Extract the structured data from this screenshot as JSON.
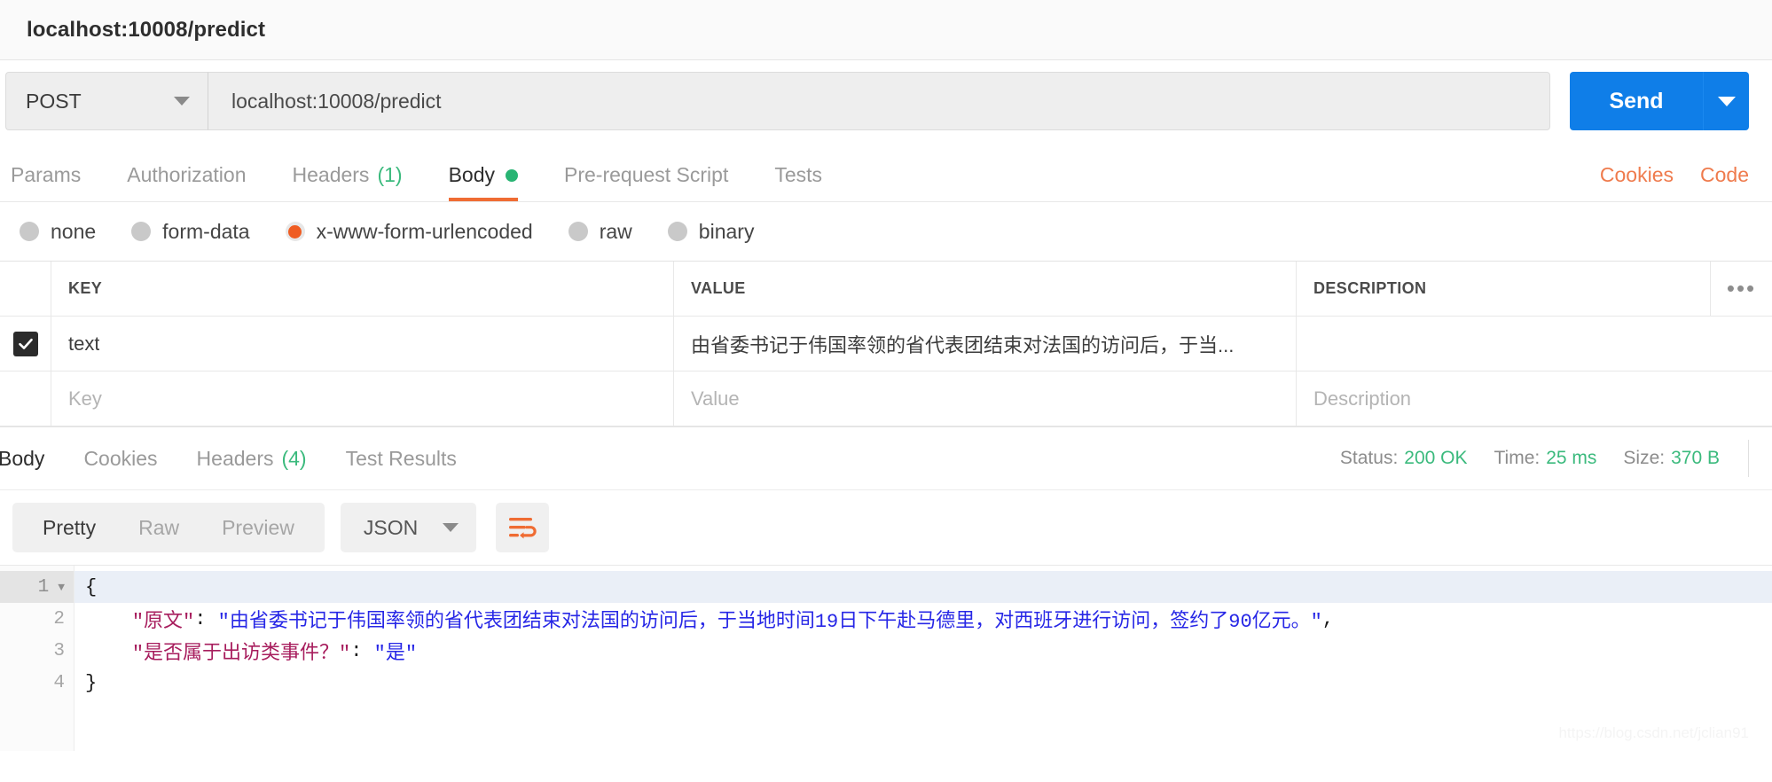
{
  "window": {
    "title": "localhost:10008/predict"
  },
  "request": {
    "method": "POST",
    "url": "localhost:10008/predict",
    "send_label": "Send",
    "tabs": [
      {
        "label": "Params",
        "count": "",
        "active": false
      },
      {
        "label": "Authorization",
        "count": "",
        "active": false
      },
      {
        "label": "Headers",
        "count": "(1)",
        "active": false
      },
      {
        "label": "Body",
        "count": "",
        "active": true
      },
      {
        "label": "Pre-request Script",
        "count": "",
        "active": false
      },
      {
        "label": "Tests",
        "count": "",
        "active": false
      }
    ],
    "links": [
      {
        "label": "Cookies"
      },
      {
        "label": "Code"
      }
    ],
    "body_types": [
      {
        "label": "none",
        "checked": false
      },
      {
        "label": "form-data",
        "checked": false
      },
      {
        "label": "x-www-form-urlencoded",
        "checked": true
      },
      {
        "label": "raw",
        "checked": false
      },
      {
        "label": "binary",
        "checked": false
      }
    ],
    "table": {
      "headers": [
        "KEY",
        "VALUE",
        "DESCRIPTION"
      ],
      "bulk_edit_icon": "•••",
      "rows": [
        {
          "checked": true,
          "key": "text",
          "value": "由省委书记于伟国率领的省代表团结束对法国的访问后，于当...",
          "description": ""
        }
      ],
      "placeholder_row": {
        "key": "Key",
        "value": "Value",
        "description": "Description"
      }
    }
  },
  "response": {
    "tabs": [
      {
        "label": "Body",
        "count": "",
        "active": true
      },
      {
        "label": "Cookies",
        "count": "",
        "active": false
      },
      {
        "label": "Headers",
        "count": "(4)",
        "active": false
      },
      {
        "label": "Test Results",
        "count": "",
        "active": false
      }
    ],
    "meta": {
      "status_label": "Status:",
      "status_value": "200 OK",
      "time_label": "Time:",
      "time_value": "25 ms",
      "size_label": "Size:",
      "size_value": "370 B"
    },
    "view_modes": [
      {
        "label": "Pretty",
        "active": true
      },
      {
        "label": "Raw",
        "active": false
      },
      {
        "label": "Preview",
        "active": false
      }
    ],
    "format": "JSON",
    "code": {
      "line_numbers": [
        "1",
        "2",
        "3",
        "4"
      ],
      "lines": [
        {
          "n": "1",
          "highlight": true,
          "fold": true,
          "parts": [
            {
              "t": "{",
              "c": "punct"
            }
          ]
        },
        {
          "n": "2",
          "highlight": false,
          "fold": false,
          "parts": [
            {
              "t": "    ",
              "c": "punct"
            },
            {
              "t": "\"原文\"",
              "c": "jkey"
            },
            {
              "t": ": ",
              "c": "punct"
            },
            {
              "t": "\"由省委书记于伟国率领的省代表团结束对法国的访问后，于当地时间19日下午赴马德里，对西班牙进行访问，签约了90亿元。\"",
              "c": "jstr"
            },
            {
              "t": ",",
              "c": "punct"
            }
          ]
        },
        {
          "n": "3",
          "highlight": false,
          "fold": false,
          "parts": [
            {
              "t": "    ",
              "c": "punct"
            },
            {
              "t": "\"是否属于出访类事件？\"",
              "c": "jkey"
            },
            {
              "t": ": ",
              "c": "punct"
            },
            {
              "t": "\"是\"",
              "c": "jstr"
            }
          ]
        },
        {
          "n": "4",
          "highlight": false,
          "fold": false,
          "parts": [
            {
              "t": "}",
              "c": "punct"
            }
          ]
        }
      ]
    }
  },
  "watermark": "https://blog.csdn.net/jclian91",
  "colors": {
    "accent_orange": "#ef6c33",
    "send_blue": "#0f7ee8",
    "status_green": "#3bba7d",
    "json_key": "#a71d5d",
    "json_string": "#2727e6"
  }
}
